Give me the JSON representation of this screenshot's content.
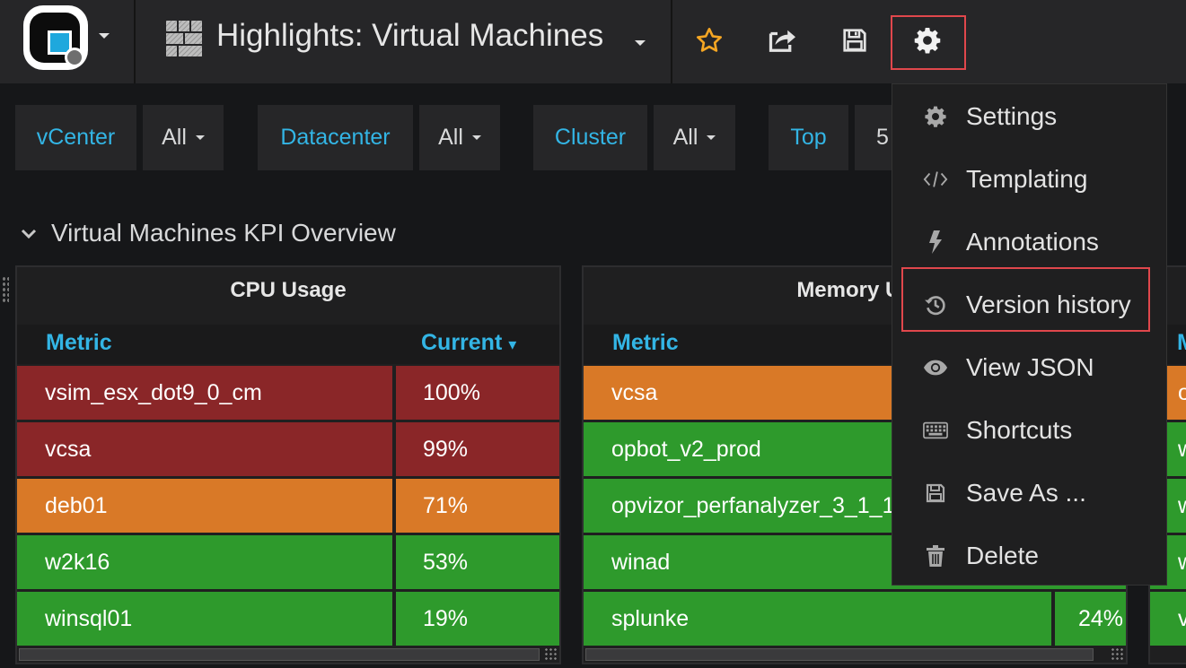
{
  "navbar": {
    "logo_icon": "grafana-logo-icon",
    "dashboard_title": "Highlights: Virtual Machines",
    "buttons": [
      "star-icon",
      "share-icon",
      "save-icon",
      "gear-icon"
    ]
  },
  "variables": [
    {
      "label": "vCenter",
      "value": "All"
    },
    {
      "label": "Datacenter",
      "value": "All"
    },
    {
      "label": "Cluster",
      "value": "All"
    },
    {
      "label": "Top",
      "value": "5"
    }
  ],
  "row": {
    "title": "Virtual Machines KPI Overview"
  },
  "panels": [
    {
      "title": "CPU Usage",
      "columns": [
        "Metric",
        "Current"
      ],
      "sort_indicator": "▾",
      "rows": [
        {
          "metric": "vsim_esx_dot9_0_cm",
          "current": "100%",
          "color": "#8a2628"
        },
        {
          "metric": "vcsa",
          "current": "99%",
          "color": "#8a2628"
        },
        {
          "metric": "deb01",
          "current": "71%",
          "color": "#d97927"
        },
        {
          "metric": "w2k16",
          "current": "53%",
          "color": "#2e9a2c"
        },
        {
          "metric": "winsql01",
          "current": "19%",
          "color": "#2e9a2c"
        }
      ]
    },
    {
      "title": "Memory Us",
      "columns": [
        "Metric"
      ],
      "rows": [
        {
          "metric": "vcsa",
          "current": "",
          "color": "#d97927"
        },
        {
          "metric": "opbot_v2_prod",
          "current": "",
          "color": "#2e9a2c"
        },
        {
          "metric": "opvizor_perfanalyzer_3_1_1",
          "current": "",
          "color": "#2e9a2c"
        },
        {
          "metric": "winad",
          "current": "",
          "color": "#2e9a2c"
        },
        {
          "metric": "splunke",
          "current": "24%",
          "color": "#2e9a2c"
        }
      ]
    },
    {
      "title": "",
      "columns": [
        "M"
      ],
      "rows": [
        {
          "metric": "o",
          "color": "#d97927"
        },
        {
          "metric": "w",
          "color": "#2e9a2c"
        },
        {
          "metric": "w",
          "color": "#2e9a2c"
        },
        {
          "metric": "w",
          "color": "#2e9a2c"
        },
        {
          "metric": "v",
          "color": "#2e9a2c"
        }
      ]
    }
  ],
  "settings_menu": {
    "items": [
      {
        "label": "Settings",
        "icon": "gear-icon"
      },
      {
        "label": "Templating",
        "icon": "code-icon"
      },
      {
        "label": "Annotations",
        "icon": "bolt-icon"
      },
      {
        "label": "Version history",
        "icon": "history-icon"
      },
      {
        "label": "View JSON",
        "icon": "eye-icon"
      },
      {
        "label": "Shortcuts",
        "icon": "keyboard-icon"
      },
      {
        "label": "Save As ...",
        "icon": "save-icon"
      },
      {
        "label": "Delete",
        "icon": "trash-icon"
      }
    ]
  },
  "colors": {
    "accent": "#33b5e5",
    "highlight": "#e0474c",
    "critical": "#8a2628",
    "warning": "#d97927",
    "ok": "#2e9a2c"
  }
}
